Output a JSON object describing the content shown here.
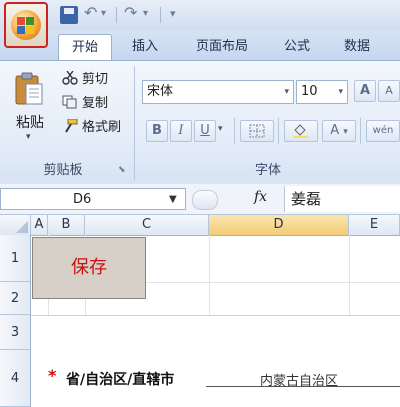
{
  "quick_access": {
    "undo_glyph": "↶",
    "redo_glyph": "↷",
    "dropdown_glyph": "▾",
    "customize_glyph": "▾"
  },
  "tabs": [
    "开始",
    "插入",
    "页面布局",
    "公式",
    "数据"
  ],
  "ribbon": {
    "clipboard": {
      "paste_label": "粘贴",
      "paste_arrow": "▾",
      "cut_label": "剪切",
      "copy_label": "复制",
      "format_painter_label": "格式刷",
      "group_label": "剪贴板"
    },
    "font": {
      "font_name": "宋体",
      "font_size": "10",
      "bold": "B",
      "italic": "I",
      "underline": "U",
      "grow_font": "A",
      "shrink_font": "A",
      "font_color": "A",
      "phonetic": "wén",
      "group_label": "字体"
    }
  },
  "formula_bar": {
    "cell_ref": "D6",
    "fx_label": "fx",
    "value": "姜磊"
  },
  "sheet": {
    "columns": [
      "A",
      "B",
      "C",
      "D",
      "E"
    ],
    "rows": [
      "1",
      "2",
      "3",
      "4"
    ],
    "save_button_label": "保存",
    "required_mark": "*",
    "province_label": "省/自治区/直辖市",
    "province_value": "内蒙古自治区"
  },
  "colors": {
    "active_column": "#f6d58a",
    "office_button_border": "#cc2222",
    "save_text": "#cc1111"
  }
}
